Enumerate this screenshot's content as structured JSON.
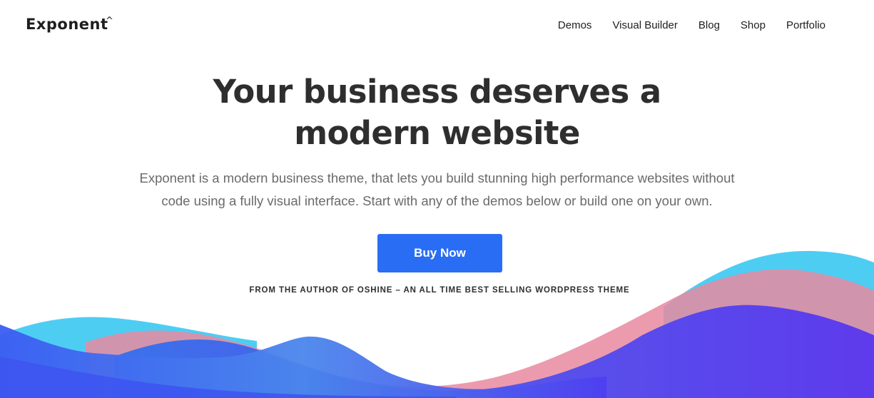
{
  "header": {
    "logo_text": "Exponent",
    "logo_mark": "^",
    "nav": [
      {
        "label": "Demos"
      },
      {
        "label": "Visual Builder"
      },
      {
        "label": "Blog"
      },
      {
        "label": "Shop"
      },
      {
        "label": "Portfolio"
      }
    ]
  },
  "hero": {
    "title_lines": [
      "Your business deserves a",
      "modern website"
    ],
    "subtitle_lines": [
      "Exponent is a modern business theme, that lets you build stunning high performance websites without",
      "code using a fully visual interface. Start with any of the demos below or build one on your own."
    ],
    "cta_label": "Buy Now",
    "tagline": "FROM THE AUTHOR OF OSHINE – AN ALL TIME BEST SELLING WORDPRESS THEME"
  },
  "colors": {
    "accent": "#2a6df5",
    "wave_cyan": "#4ecdf3",
    "wave_pink": "#e98aa0",
    "wave_purple": "#5a3ff0",
    "wave_blue": "#3b6df0"
  }
}
